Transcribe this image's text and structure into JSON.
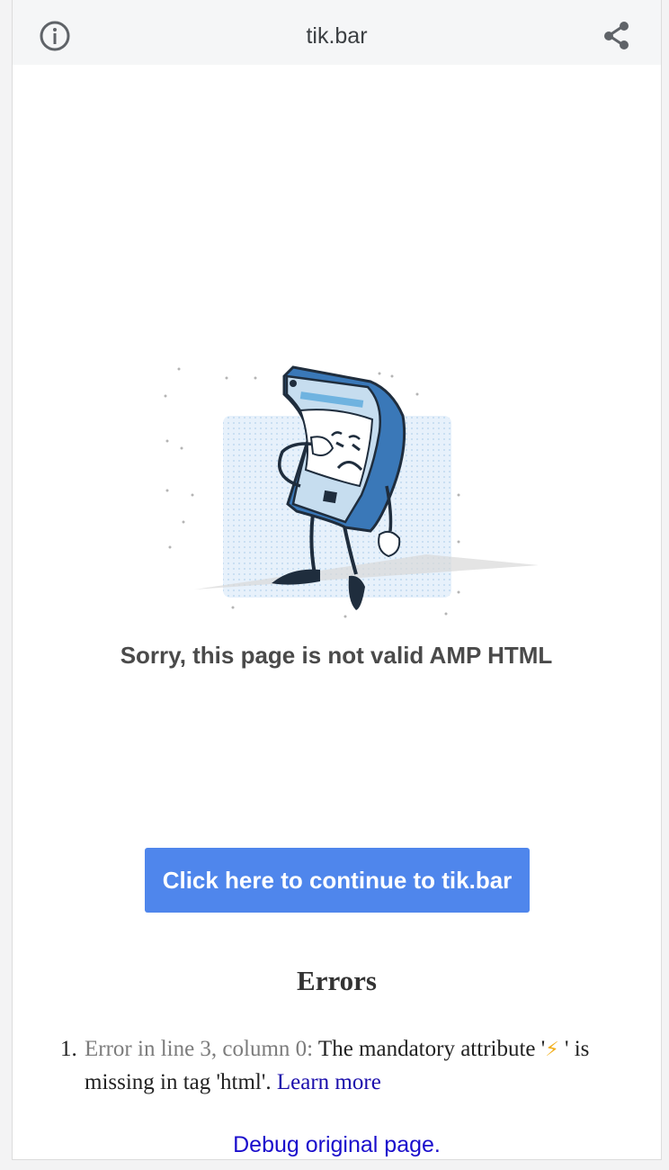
{
  "header": {
    "title": "tik.bar",
    "info_icon": "info-icon",
    "share_icon": "share-icon"
  },
  "main": {
    "headline": "Sorry, this page is not valid AMP HTML",
    "continue_button": "Click here to continue to tik.bar",
    "illustration": "sad-phone-illustration"
  },
  "errors": {
    "heading": "Errors",
    "items": [
      {
        "number": "1.",
        "location": "Error in line 3, column 0:",
        "message_pre": " The mandatory attribute '",
        "bolt": "⚡",
        "message_post": " ' is missing in tag 'html'. ",
        "link": "Learn more"
      }
    ]
  },
  "footer": {
    "debug_link": "Debug original page."
  },
  "colors": {
    "button": "#4f86ec",
    "link": "#1a0dab",
    "bolt": "#f2b01e"
  }
}
